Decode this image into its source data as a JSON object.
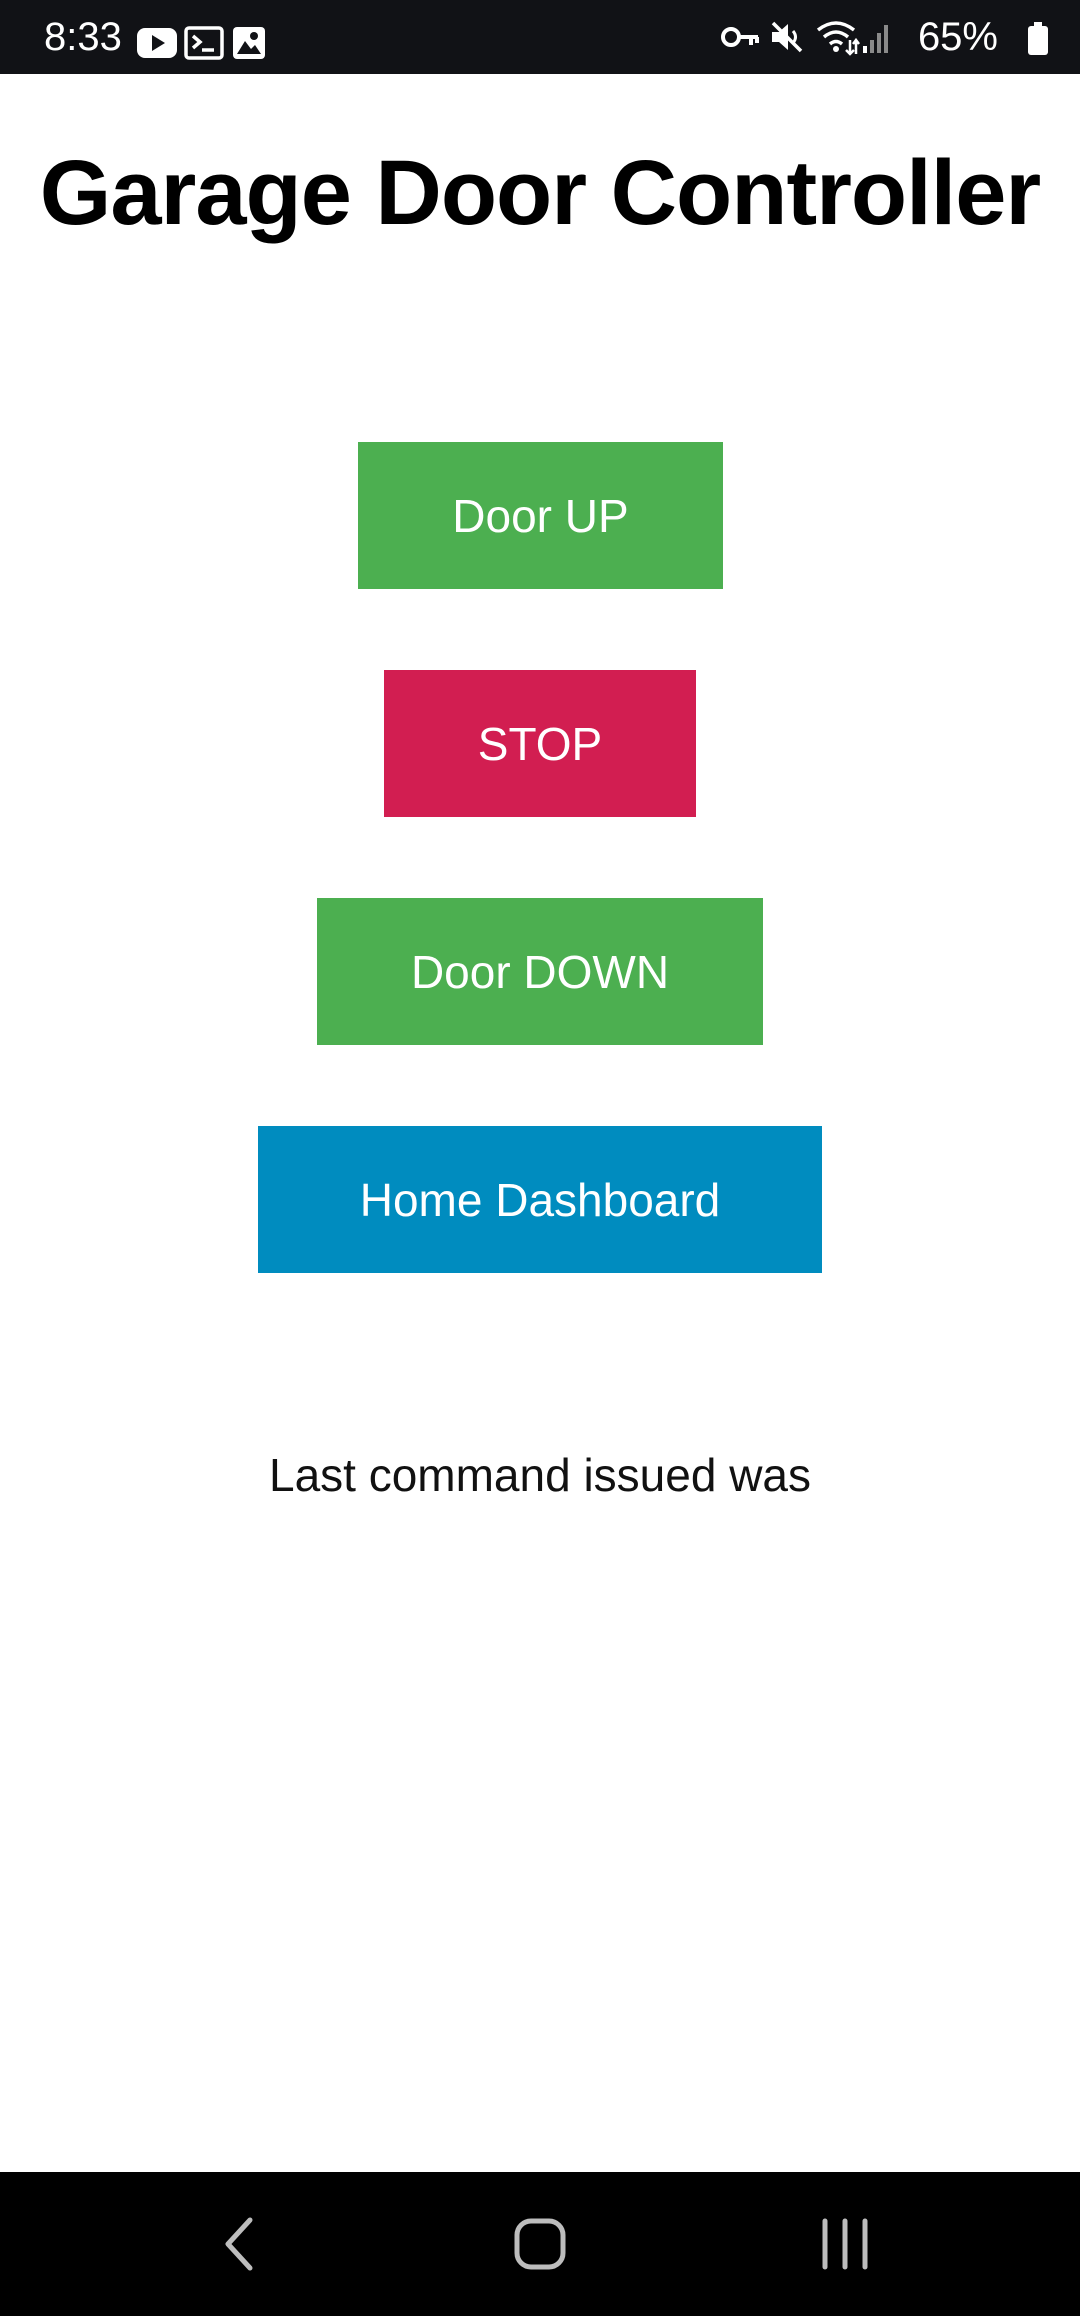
{
  "status_bar": {
    "time": "8:33",
    "battery_percent": "65%",
    "left_icons": [
      "youtube-icon",
      "terminal-icon",
      "gallery-icon"
    ],
    "right_icons": [
      "vpn-key-icon",
      "mute-icon",
      "wifi-icon",
      "signal-icon",
      "battery-icon"
    ]
  },
  "page": {
    "title": "Garage Door Controller",
    "buttons": {
      "door_up": "Door UP",
      "stop": "STOP",
      "door_down": "Door DOWN",
      "home_dashboard": "Home Dashboard"
    },
    "last_command_text": "Last command issued was"
  },
  "colors": {
    "status_bar_bg": "#111216",
    "green": "#4caf50",
    "stop_red": "#d21e51",
    "dashboard_blue": "#008cbf",
    "nav_bar_bg": "#000000"
  },
  "nav_bar": {
    "buttons": [
      "back-icon",
      "home-icon",
      "recents-icon"
    ]
  }
}
